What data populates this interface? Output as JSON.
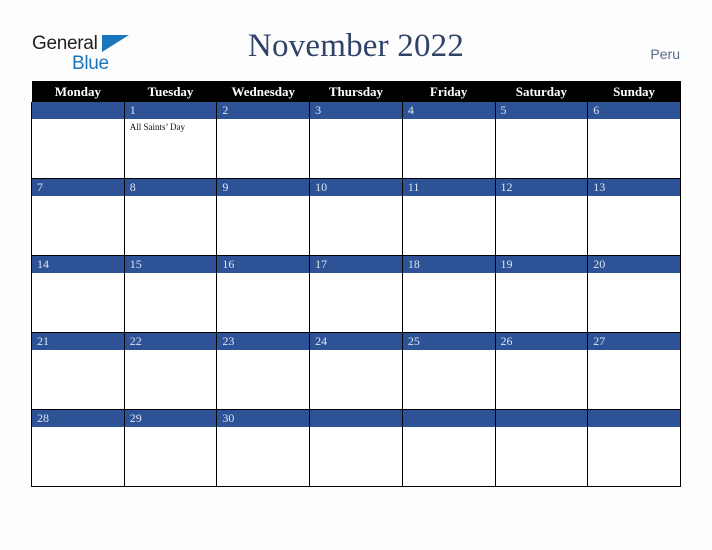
{
  "brand": {
    "word_one": "General",
    "word_two": "Blue",
    "triangle_icon": "triangle-icon",
    "color_dark": "#231f20",
    "color_blue": "#1b75bb"
  },
  "header": {
    "title": "November 2022",
    "country": "Peru",
    "title_color": "#2f4468",
    "country_color": "#566a8c"
  },
  "calendar": {
    "accent_color": "#2d5295",
    "header_bg": "#000000",
    "weekdays": [
      "Monday",
      "Tuesday",
      "Wednesday",
      "Thursday",
      "Friday",
      "Saturday",
      "Sunday"
    ],
    "weeks": [
      [
        {
          "day": "",
          "events": []
        },
        {
          "day": "1",
          "events": [
            "All Saints’ Day"
          ]
        },
        {
          "day": "2",
          "events": []
        },
        {
          "day": "3",
          "events": []
        },
        {
          "day": "4",
          "events": []
        },
        {
          "day": "5",
          "events": []
        },
        {
          "day": "6",
          "events": []
        }
      ],
      [
        {
          "day": "7",
          "events": []
        },
        {
          "day": "8",
          "events": []
        },
        {
          "day": "9",
          "events": []
        },
        {
          "day": "10",
          "events": []
        },
        {
          "day": "11",
          "events": []
        },
        {
          "day": "12",
          "events": []
        },
        {
          "day": "13",
          "events": []
        }
      ],
      [
        {
          "day": "14",
          "events": []
        },
        {
          "day": "15",
          "events": []
        },
        {
          "day": "16",
          "events": []
        },
        {
          "day": "17",
          "events": []
        },
        {
          "day": "18",
          "events": []
        },
        {
          "day": "19",
          "events": []
        },
        {
          "day": "20",
          "events": []
        }
      ],
      [
        {
          "day": "21",
          "events": []
        },
        {
          "day": "22",
          "events": []
        },
        {
          "day": "23",
          "events": []
        },
        {
          "day": "24",
          "events": []
        },
        {
          "day": "25",
          "events": []
        },
        {
          "day": "26",
          "events": []
        },
        {
          "day": "27",
          "events": []
        }
      ],
      [
        {
          "day": "28",
          "events": []
        },
        {
          "day": "29",
          "events": []
        },
        {
          "day": "30",
          "events": []
        },
        {
          "day": "",
          "events": []
        },
        {
          "day": "",
          "events": []
        },
        {
          "day": "",
          "events": []
        },
        {
          "day": "",
          "events": []
        }
      ]
    ]
  }
}
